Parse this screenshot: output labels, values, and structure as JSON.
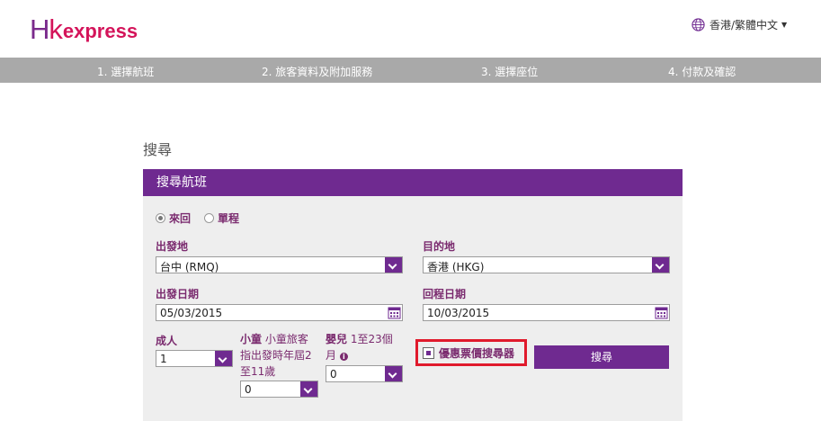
{
  "header": {
    "logo": {
      "hk": "Hk",
      "text": "express"
    },
    "language": {
      "label": "香港/繁體中文",
      "icon": "globe-icon"
    }
  },
  "steps": [
    {
      "label": "1. 選擇航班"
    },
    {
      "label": "2. 旅客資料及附加服務"
    },
    {
      "label": "3. 選擇座位"
    },
    {
      "label": "4. 付款及確認"
    }
  ],
  "page": {
    "title": "搜尋"
  },
  "panel": {
    "title": "搜尋航班",
    "trip_type": {
      "options": [
        "來回",
        "單程"
      ],
      "selected": "來回"
    },
    "origin": {
      "label": "出發地",
      "value": "台中 (RMQ)"
    },
    "destination": {
      "label": "目的地",
      "value": "香港 (HKG)"
    },
    "depart_date": {
      "label": "出發日期",
      "value": "05/03/2015"
    },
    "return_date": {
      "label": "回程日期",
      "value": "10/03/2015"
    },
    "adults": {
      "label": "成人",
      "value": "1"
    },
    "children": {
      "label": "小童",
      "desc": "小童旅客指出發時年屆2至11歲",
      "value": "0"
    },
    "infants": {
      "label": "嬰兒",
      "desc": "1至23個月",
      "value": "0"
    },
    "fare_finder": {
      "label": "優惠票價搜尋器",
      "checked": true
    },
    "search_button": "搜尋"
  },
  "colors": {
    "accent": "#6f2a90",
    "brand_pink": "#d4145a",
    "highlight_box": "#e01a2c",
    "steps_bar": "#a9a9a9"
  }
}
